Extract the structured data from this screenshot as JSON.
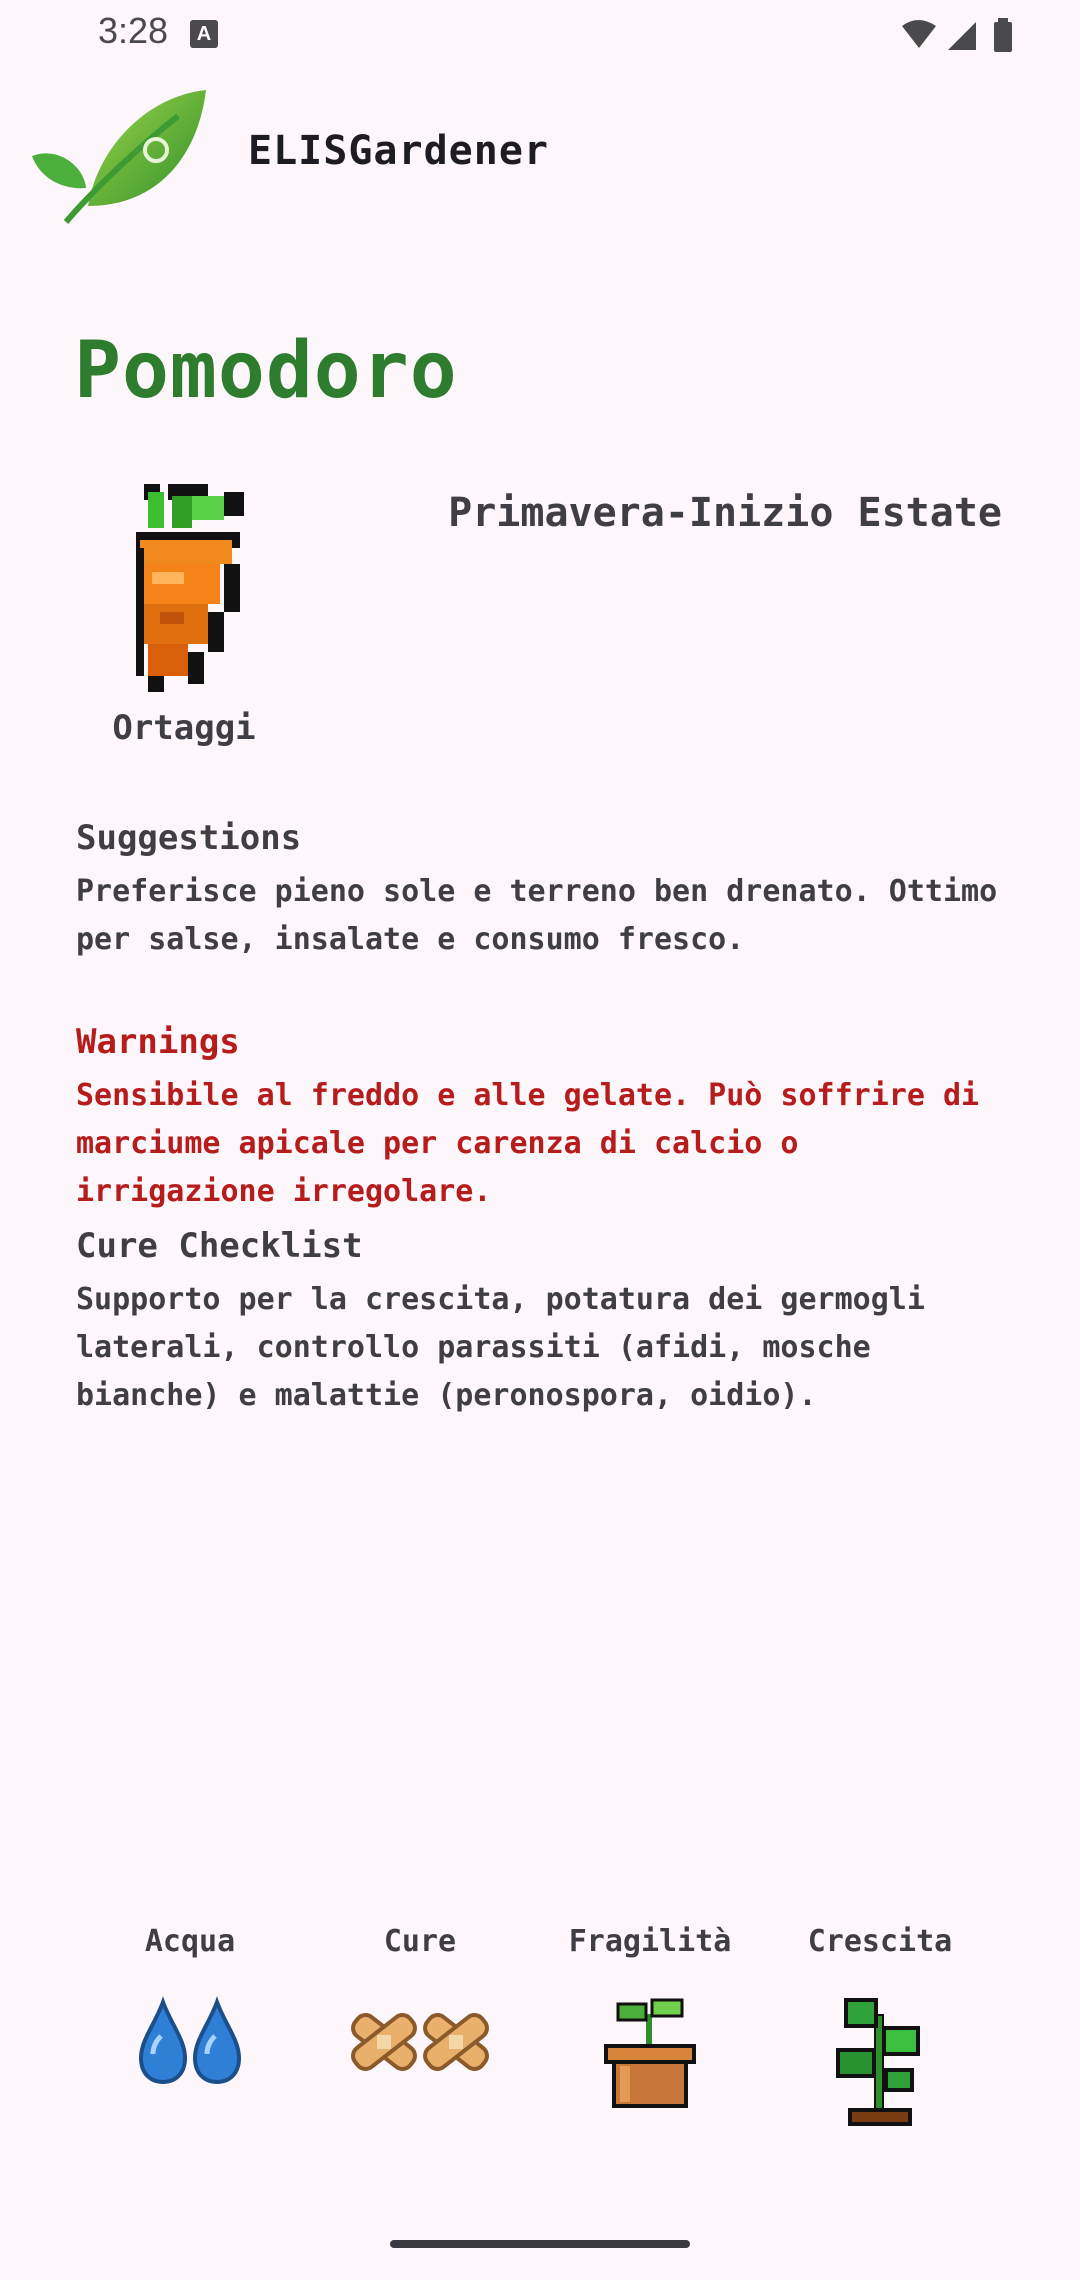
{
  "status_bar": {
    "time": "3:28",
    "notification_icon": "A"
  },
  "header": {
    "app_title": "ELISGardener",
    "logo_icon": "leaf-icon"
  },
  "plant": {
    "name": "Pomodoro",
    "category_icon": "carrot-icon",
    "category": "Ortaggi",
    "season": "Primavera-Inizio Estate"
  },
  "sections": {
    "suggestions": {
      "title": "Suggestions",
      "text": "Preferisce pieno sole e terreno ben drenato. Ottimo per salse, insalate e consumo fresco."
    },
    "warnings": {
      "title": "Warnings",
      "text": "Sensibile al freddo e alle gelate. Può soffrire di marciume apicale per carenza di calcio o irrigazione irregolare."
    },
    "cure_checklist": {
      "title": "Cure Checklist",
      "text": "Supporto per la crescita, potatura dei germogli laterali, controllo parassiti (afidi, mosche bianche) e malattie (peronospora, oidio)."
    }
  },
  "stats": [
    {
      "label": "Acqua",
      "icon": "water-drops-icon"
    },
    {
      "label": "Cure",
      "icon": "bandage-icon"
    },
    {
      "label": "Fragilità",
      "icon": "potted-sprout-icon"
    },
    {
      "label": "Crescita",
      "icon": "seedling-icon"
    }
  ],
  "colors": {
    "background": "#fdf6fb",
    "title_green": "#2e7d2f",
    "warning_red": "#b71c1c",
    "text": "#3f3e44"
  }
}
